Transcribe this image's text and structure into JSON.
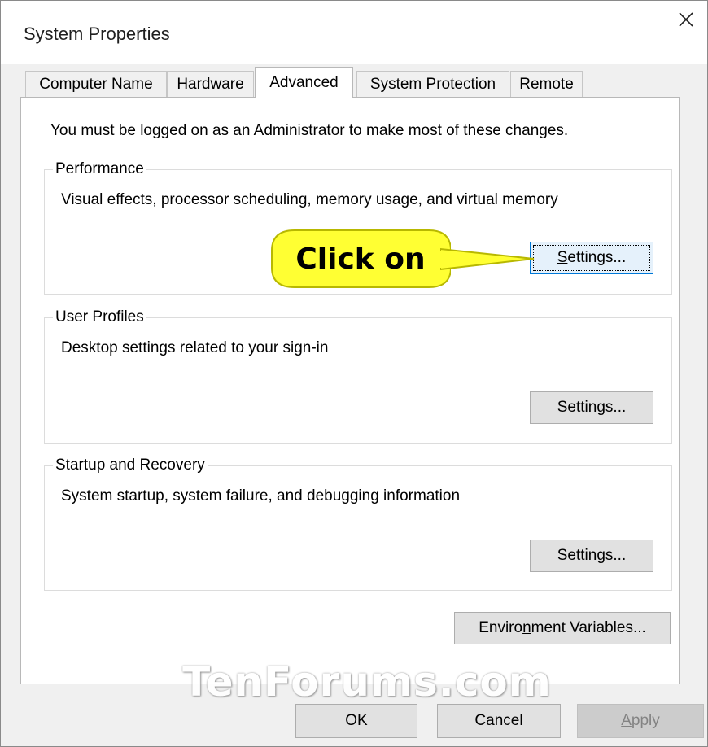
{
  "window": {
    "title": "System Properties"
  },
  "tabs": [
    {
      "label": "Computer Name"
    },
    {
      "label": "Hardware"
    },
    {
      "label": "Advanced"
    },
    {
      "label": "System Protection"
    },
    {
      "label": "Remote"
    }
  ],
  "active_tab": "Advanced",
  "admin_note": "You must be logged on as an Administrator to make most of these changes.",
  "performance": {
    "title": "Performance",
    "description": "Visual effects, processor scheduling, memory usage, and virtual memory",
    "button": {
      "pre": "",
      "mnemonic": "S",
      "post": "ettings..."
    }
  },
  "user_profiles": {
    "title": "User Profiles",
    "description": "Desktop settings related to your sign-in",
    "button": {
      "pre": "S",
      "mnemonic": "e",
      "post": "ttings..."
    }
  },
  "startup_recovery": {
    "title": "Startup and Recovery",
    "description": "System startup, system failure, and debugging information",
    "button": {
      "pre": "Se",
      "mnemonic": "t",
      "post": "tings..."
    }
  },
  "env_button": {
    "pre": "Enviro",
    "mnemonic": "n",
    "post": "ment Variables..."
  },
  "callout": {
    "text": "Click on",
    "fill": "#ffff33",
    "border": "#b8b800"
  },
  "footer": {
    "ok": "OK",
    "cancel": "Cancel",
    "apply": {
      "mnemonic": "A",
      "post": "pply"
    }
  },
  "watermark": "TenForums.com",
  "colors": {
    "focus_border": "#0078d7",
    "button_face": "#e1e1e1",
    "dialog_bg": "#f0f0f0"
  }
}
